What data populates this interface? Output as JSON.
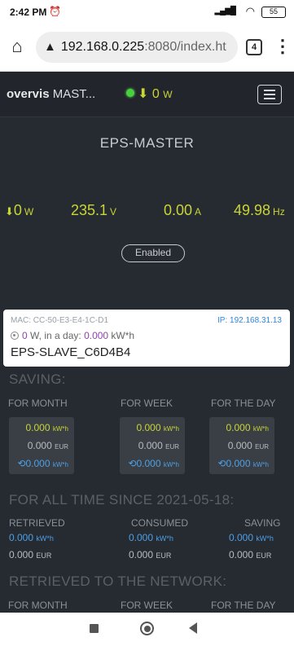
{
  "status_bar": {
    "time": "2:42 PM",
    "alarm_icon": "alarm-clock-icon",
    "battery": "55"
  },
  "browser": {
    "url_warning_icon": "warning-icon",
    "url_host": "192.168.0.225",
    "url_rest": ":8080/index.ht",
    "tab_count": "4"
  },
  "app_header": {
    "brand_bold": "overvis",
    "brand_rest": " MAST...",
    "power_arrow": "⬇",
    "power_value": "0",
    "power_unit": "W"
  },
  "device": {
    "title": "EPS-MASTER"
  },
  "metrics": {
    "power_arrow": "⬇",
    "power_value": "0",
    "power_unit": "W",
    "voltage_value": "235.1",
    "voltage_unit": "V",
    "current_value": "0.00",
    "current_unit": "A",
    "frequency_value": "49.98",
    "frequency_unit": "Hz"
  },
  "enabled_badge": "Enabled",
  "slave": {
    "mac": "MAC: CC-50-E3-E4-1C-D1",
    "ip": "IP: 192.168.31.13",
    "power_value": "0",
    "power_text": " W, in a day: ",
    "day_energy": "0.000",
    "day_energy_unit": " kW*h",
    "name": "EPS-SLAVE_C6D4B4"
  },
  "saving": {
    "title": "SAVING:",
    "columns": [
      {
        "header": "FOR MONTH",
        "energy": "0.000",
        "energy_unit": "kW*h",
        "cost": "0.000",
        "cost_unit": "EUR",
        "returned": "0.000",
        "returned_unit": "kW*h"
      },
      {
        "header": "FOR WEEK",
        "energy": "0.000",
        "energy_unit": "kW*h",
        "cost": "0.000",
        "cost_unit": "EUR",
        "returned": "0.000",
        "returned_unit": "kW*h"
      },
      {
        "header": "FOR THE DAY",
        "energy": "0.000",
        "energy_unit": "kW*h",
        "cost": "0.000",
        "cost_unit": "EUR",
        "returned": "0.000",
        "returned_unit": "kW*h"
      }
    ]
  },
  "all_time": {
    "title": "FOR ALL TIME SINCE 2021-05-18:",
    "columns": [
      {
        "header": "RETRIEVED",
        "energy": "0.000",
        "energy_unit": "kW*h",
        "cost": "0.000",
        "cost_unit": "EUR"
      },
      {
        "header": "CONSUMED",
        "energy": "0.000",
        "energy_unit": "kW*h",
        "cost": "0.000",
        "cost_unit": "EUR"
      },
      {
        "header": "SAVING",
        "energy": "0.000",
        "energy_unit": "kW*h",
        "cost": "0.000",
        "cost_unit": "EUR"
      }
    ]
  },
  "network": {
    "title": "RETRIEVED TO THE NETWORK:",
    "columns": [
      "FOR MONTH",
      "FOR WEEK",
      "FOR THE DAY"
    ]
  }
}
